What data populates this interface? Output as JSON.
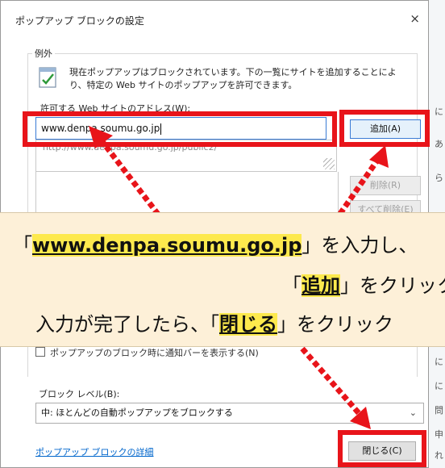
{
  "dialog": {
    "title": "ポップアップ ブロックの設定",
    "close_symbol": "×"
  },
  "exceptions": {
    "section_label": "例外",
    "description": "現在ポップアップはブロックされています。下の一覧にサイトを追加することにより、特定の Web サイトのポップアップを許可できます。",
    "address_label": "許可する Web サイトのアドレス(W):",
    "address_value": "www.denpa.soumu.go.jp",
    "suggestion": "http://www.denpa.soumu.go.jp/public2/"
  },
  "buttons": {
    "add": "追加(A)",
    "remove": "削除(R)",
    "remove_all": "すべて削除(E)",
    "close": "閉じる(C)"
  },
  "notification": {
    "label": "ポップアップのブロック時に通知バーを表示する(N)"
  },
  "block_level": {
    "label": "ブロック レベル(B):",
    "selected": "中: ほとんどの自動ポップアップをブロックする"
  },
  "details_link": "ポップアップ ブロックの詳細",
  "annotation": {
    "line1_open": "「",
    "line1_hl": "www.denpa.soumu.go.jp",
    "line1_rest": "」を入力し、",
    "line2_open": "「",
    "line2_hl": "追加",
    "line2_rest": "」をクリック",
    "line3_pre": "入力が完了したら、「",
    "line3_hl": "閉じる",
    "line3_rest": "」をクリック"
  },
  "background_chars": [
    "に",
    "あ",
    "ら",
    "に",
    "に",
    "問",
    "申",
    "れ"
  ],
  "colors": {
    "highlight_red": "#e8141a",
    "overlay_bg": "#fdf0d8",
    "text_highlight": "#fde94d",
    "link_blue": "#0066cc"
  }
}
